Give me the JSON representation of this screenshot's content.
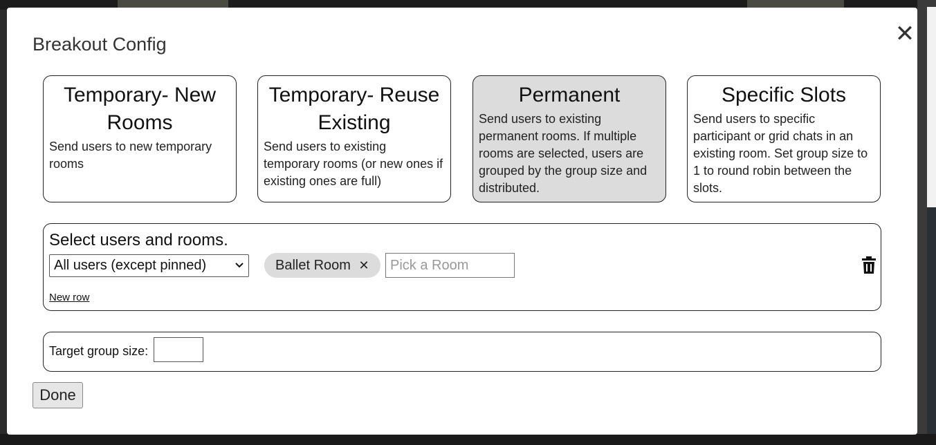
{
  "modal": {
    "title": "Breakout Config",
    "close_icon": "close-icon",
    "close_glyph": "✕"
  },
  "modes": [
    {
      "title": "Temporary- New Rooms",
      "description": "Send users to new temporary rooms",
      "selected": false
    },
    {
      "title": "Temporary- Reuse Existing",
      "description": "Send users to existing temporary rooms (or new ones if existing ones are full)",
      "selected": false
    },
    {
      "title": "Permanent",
      "description": "Send users to existing permanent rooms. If multiple rooms are selected, users are grouped by the group size and distributed.",
      "selected": true
    },
    {
      "title": "Specific Slots",
      "description": "Send users to specific participant or grid chats in an existing room. Set group size to 1 to round robin between the slots.",
      "selected": false
    }
  ],
  "users_section": {
    "heading": "Select users and rooms.",
    "user_select_value": "All users (except pinned)",
    "room_chip_label": "Ballet Room",
    "room_chip_remove": "✕",
    "room_input_placeholder": "Pick a Room",
    "room_input_value": "",
    "trash_icon": "trash-icon",
    "new_row_label": "New row"
  },
  "group_section": {
    "label": "Target group size:",
    "value": ""
  },
  "done_label": "Done"
}
